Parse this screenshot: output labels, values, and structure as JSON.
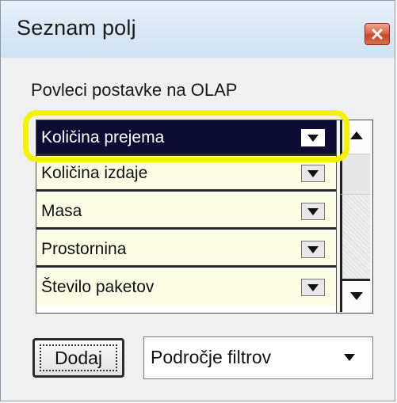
{
  "window": {
    "title": "Seznam polj",
    "close_icon": "close-icon"
  },
  "panel": {
    "instruction": "Povleci postavke na OLAP",
    "fields": [
      {
        "label": "Količina prejema",
        "selected": true
      },
      {
        "label": "Količina izdaje",
        "selected": false
      },
      {
        "label": "Masa",
        "selected": false
      },
      {
        "label": "Prostornina",
        "selected": false
      },
      {
        "label": "Število paketov",
        "selected": false
      }
    ],
    "add_button_label": "Dodaj",
    "target_area": "Področje filtrov"
  },
  "colors": {
    "selected_row_bg": "#0c0c34",
    "row_bg": "#fdfde6",
    "highlight": "#f3f300",
    "close_button": "#c8452a"
  }
}
